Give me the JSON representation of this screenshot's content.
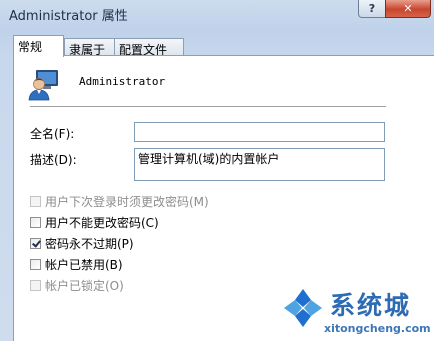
{
  "window": {
    "title": "Administrator 属性",
    "help_label": "?",
    "close_label": "✕"
  },
  "tabs": [
    {
      "label": "常规",
      "active": true
    },
    {
      "label": "隶属于",
      "active": false
    },
    {
      "label": "配置文件",
      "active": false
    }
  ],
  "user": {
    "icon": "user-icon",
    "name": "Administrator"
  },
  "fields": {
    "full_name_label": "全名(F):",
    "full_name_value": "",
    "description_label": "描述(D):",
    "description_value": "管理计算机(域)的内置帐户"
  },
  "options": [
    {
      "label": "用户下次登录时须更改密码(M)",
      "checked": false,
      "enabled": false
    },
    {
      "label": "用户不能更改密码(C)",
      "checked": false,
      "enabled": true
    },
    {
      "label": "密码永不过期(P)",
      "checked": true,
      "enabled": true
    },
    {
      "label": "帐户已禁用(B)",
      "checked": false,
      "enabled": true
    },
    {
      "label": "帐户已锁定(O)",
      "checked": false,
      "enabled": false
    }
  ],
  "watermark": {
    "name": "系统城",
    "url": "xitongcheng.com",
    "colors": {
      "blue": "#2e6bb5",
      "light_blue": "#4ea3e0"
    }
  },
  "colors": {
    "title_bar": "#c8d8ec",
    "close_button": "#c7452d",
    "panel": "#ffffff"
  }
}
